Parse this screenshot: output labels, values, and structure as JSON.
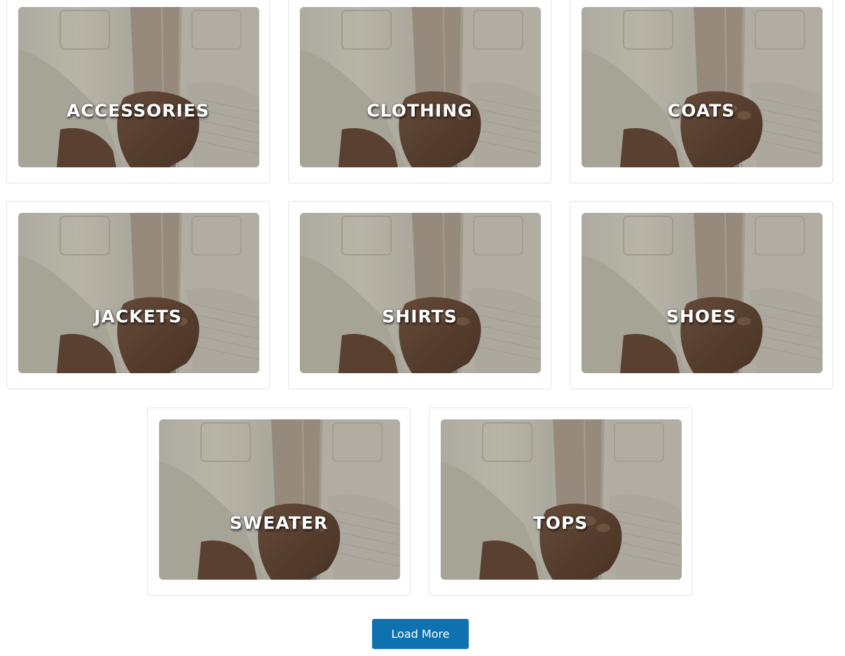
{
  "categories": [
    {
      "label": "ACCESSORIES"
    },
    {
      "label": "CLOTHING"
    },
    {
      "label": "COATS"
    },
    {
      "label": "JACKETS"
    },
    {
      "label": "SHIRTS"
    },
    {
      "label": "SHOES"
    },
    {
      "label": "SWEATER"
    },
    {
      "label": "TOPS"
    }
  ],
  "load_more": {
    "label": "Load More"
  },
  "colors": {
    "button": "#0e72b0",
    "card_border": "#e3e3e3",
    "label_text": "#ffffff"
  },
  "icons": {
    "category_image": "shirt-photo"
  }
}
